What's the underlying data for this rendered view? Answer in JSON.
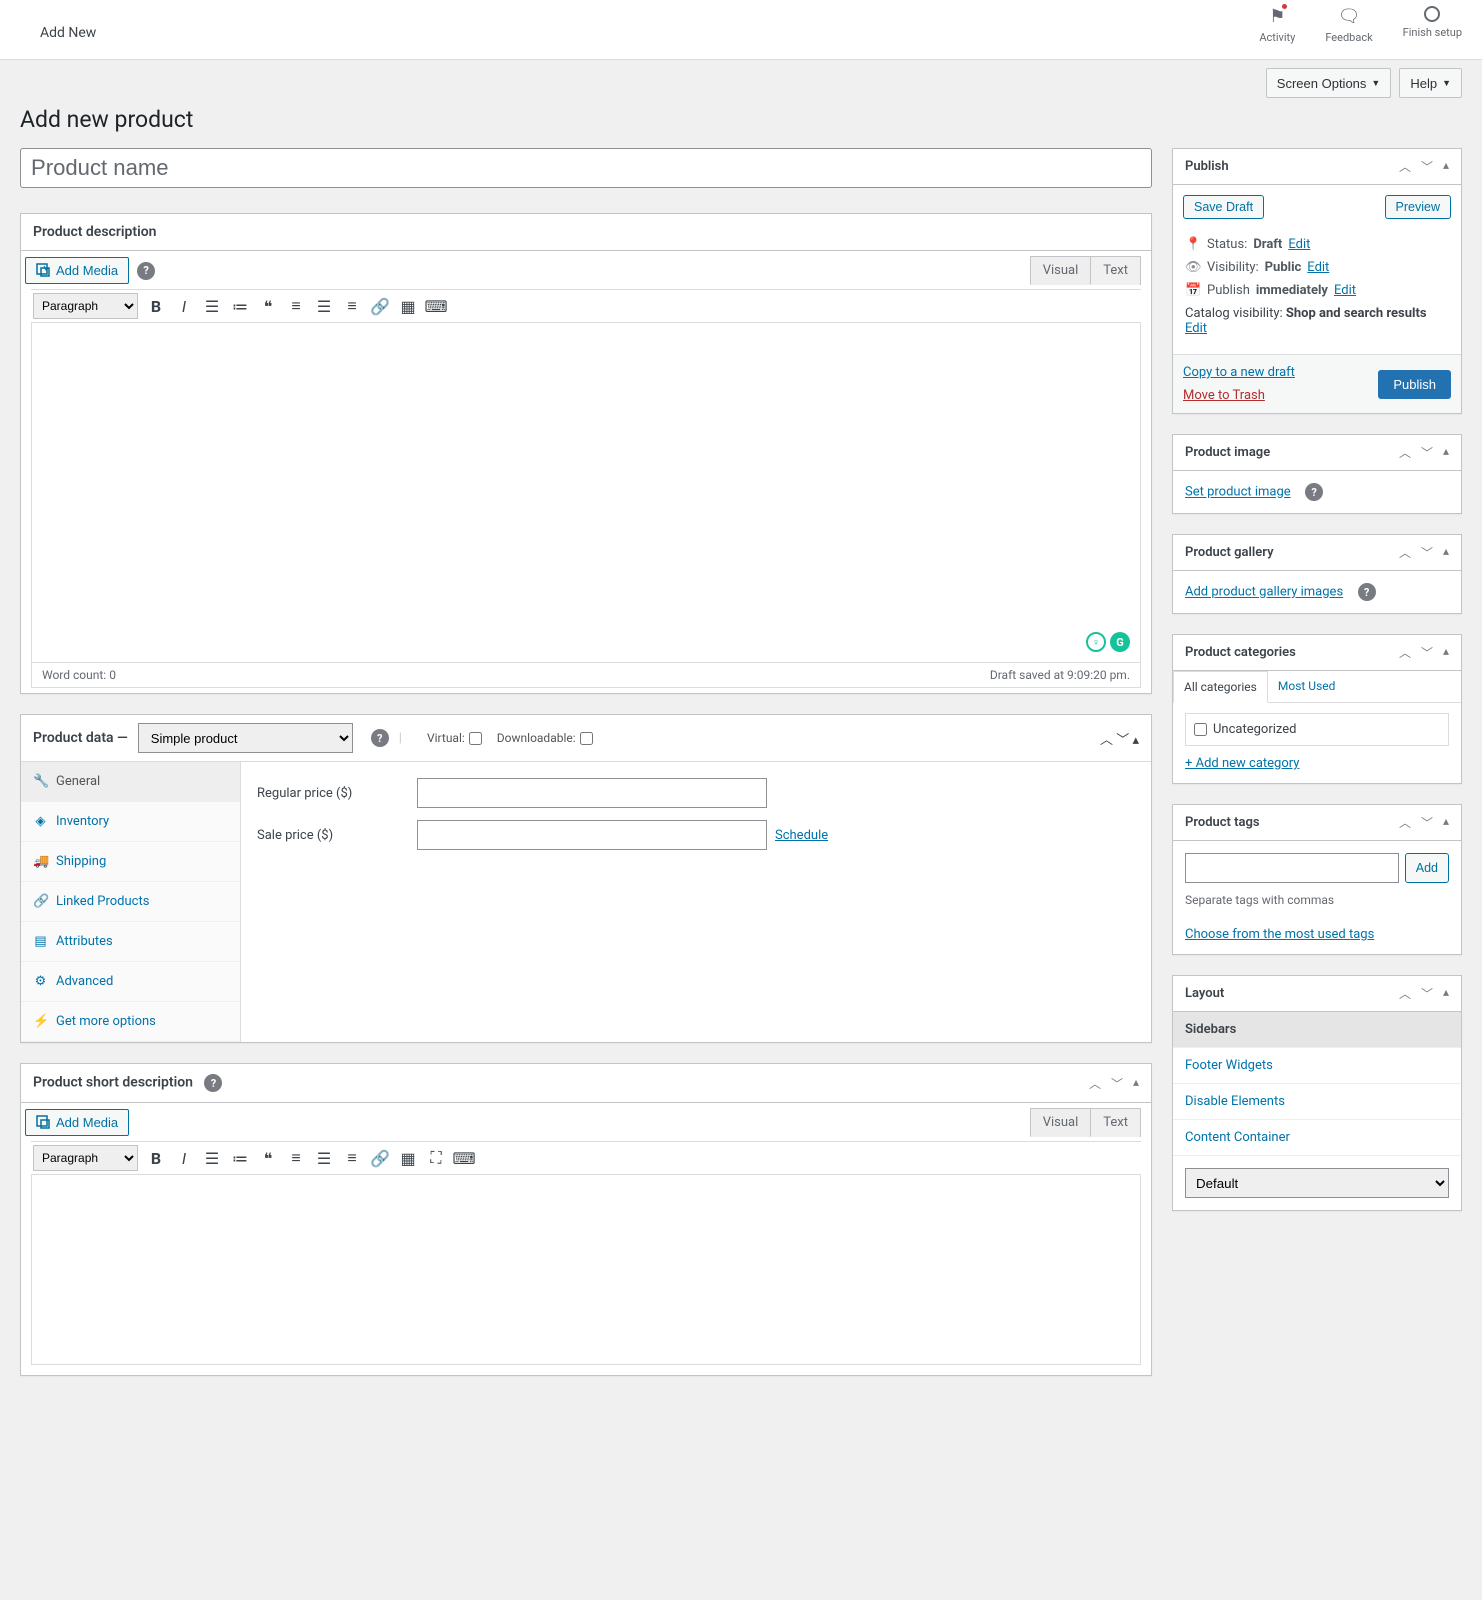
{
  "topbar": {
    "title": "Add New",
    "activity": "Activity",
    "feedback": "Feedback",
    "finish": "Finish setup"
  },
  "notices": {
    "screen_options": "Screen Options",
    "help": "Help"
  },
  "page_heading": "Add new product",
  "title_placeholder": "Product name",
  "desc": {
    "header": "Product description",
    "add_media": "Add Media",
    "tab_visual": "Visual",
    "tab_text": "Text",
    "format_sel": "Paragraph",
    "word_count_label": "Word count:",
    "word_count": "0",
    "draft_saved": "Draft saved at 9:09:20 pm."
  },
  "product_data": {
    "header": "Product data",
    "select": "Simple product",
    "virtual": "Virtual:",
    "downloadable": "Downloadable:",
    "tabs": {
      "general": "General",
      "inventory": "Inventory",
      "shipping": "Shipping",
      "linked": "Linked Products",
      "attributes": "Attributes",
      "advanced": "Advanced",
      "more": "Get more options"
    },
    "regular_price": "Regular price ($)",
    "sale_price": "Sale price ($)",
    "schedule": "Schedule"
  },
  "short_desc": {
    "header": "Product short description",
    "add_media": "Add Media",
    "tab_visual": "Visual",
    "tab_text": "Text",
    "format_sel": "Paragraph"
  },
  "publish": {
    "header": "Publish",
    "save_draft": "Save Draft",
    "preview": "Preview",
    "status_label": "Status:",
    "status_value": "Draft",
    "visibility_label": "Visibility:",
    "visibility_value": "Public",
    "publish_label": "Publish",
    "publish_value": "immediately",
    "catalog_label": "Catalog visibility:",
    "catalog_value": "Shop and search results",
    "edit": "Edit",
    "copy": "Copy to a new draft",
    "trash": "Move to Trash",
    "publish_btn": "Publish"
  },
  "product_image": {
    "header": "Product image",
    "link": "Set product image"
  },
  "gallery": {
    "header": "Product gallery",
    "link": "Add product gallery images"
  },
  "categories": {
    "header": "Product categories",
    "tab_all": "All categories",
    "tab_most": "Most Used",
    "uncat": "Uncategorized",
    "add_new": "+ Add new category"
  },
  "tags": {
    "header": "Product tags",
    "add_btn": "Add",
    "note": "Separate tags with commas",
    "choose": "Choose from the most used tags"
  },
  "layout": {
    "header": "Layout",
    "sidebars": "Sidebars",
    "footer": "Footer Widgets",
    "disable": "Disable Elements",
    "content": "Content Container",
    "default": "Default"
  }
}
